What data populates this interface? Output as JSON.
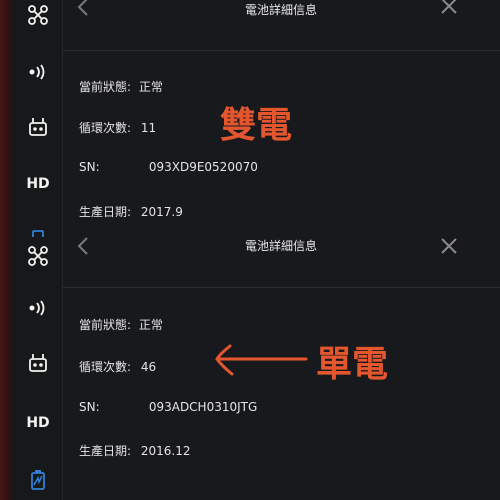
{
  "top_panel": {
    "title": "電池詳細信息",
    "sidebar": {
      "hd_label": "HD"
    },
    "fields": [
      {
        "label": "當前狀態:",
        "value": "正常"
      },
      {
        "label": "循環次數:",
        "value": "11"
      },
      {
        "label": "SN:",
        "value": "093XD9E0520070"
      },
      {
        "label": "生產日期:",
        "value": "2017.9"
      }
    ],
    "annotation": "雙電"
  },
  "bottom_panel": {
    "title": "電池詳細信息",
    "sidebar": {
      "hd_label": "HD"
    },
    "fields": [
      {
        "label": "當前狀態:",
        "value": "正常"
      },
      {
        "label": "循環次數:",
        "value": "46"
      },
      {
        "label": "SN:",
        "value": "093ADCH0310JTG"
      },
      {
        "label": "生產日期:",
        "value": "2016.12"
      }
    ],
    "annotation": "單電"
  },
  "colors": {
    "annotation": "#e4572e",
    "hd_active": "#2f7fd8",
    "background": "#18191c"
  },
  "icons": [
    "aircraft-icon",
    "signal-icon",
    "remote-controller-icon",
    "battery-icon",
    "back-chevron-icon",
    "close-icon",
    "arrow-icon"
  ]
}
